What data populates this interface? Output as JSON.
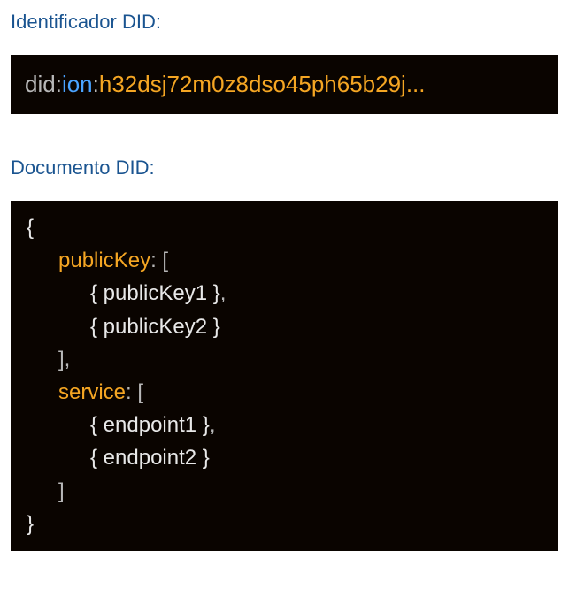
{
  "labels": {
    "identifier": "Identificador DID:",
    "document": "Documento DID:"
  },
  "did": {
    "scheme": "did",
    "method": "ion",
    "id": "h32dsj72m0z8dso45ph65b29j...",
    "sep": ":"
  },
  "doc": {
    "openBrace": "{",
    "closeBrace": "}",
    "openBracket": "[",
    "closeBracket": "]",
    "comma": ",",
    "colon": ": ",
    "keys": {
      "publicKey": "publicKey",
      "service": "service"
    },
    "items": {
      "publicKey1": "{ publicKey1 }",
      "publicKey2": "{ publicKey2 }",
      "endpoint1": "{ endpoint1 }",
      "endpoint2": "{ endpoint2 }"
    }
  }
}
